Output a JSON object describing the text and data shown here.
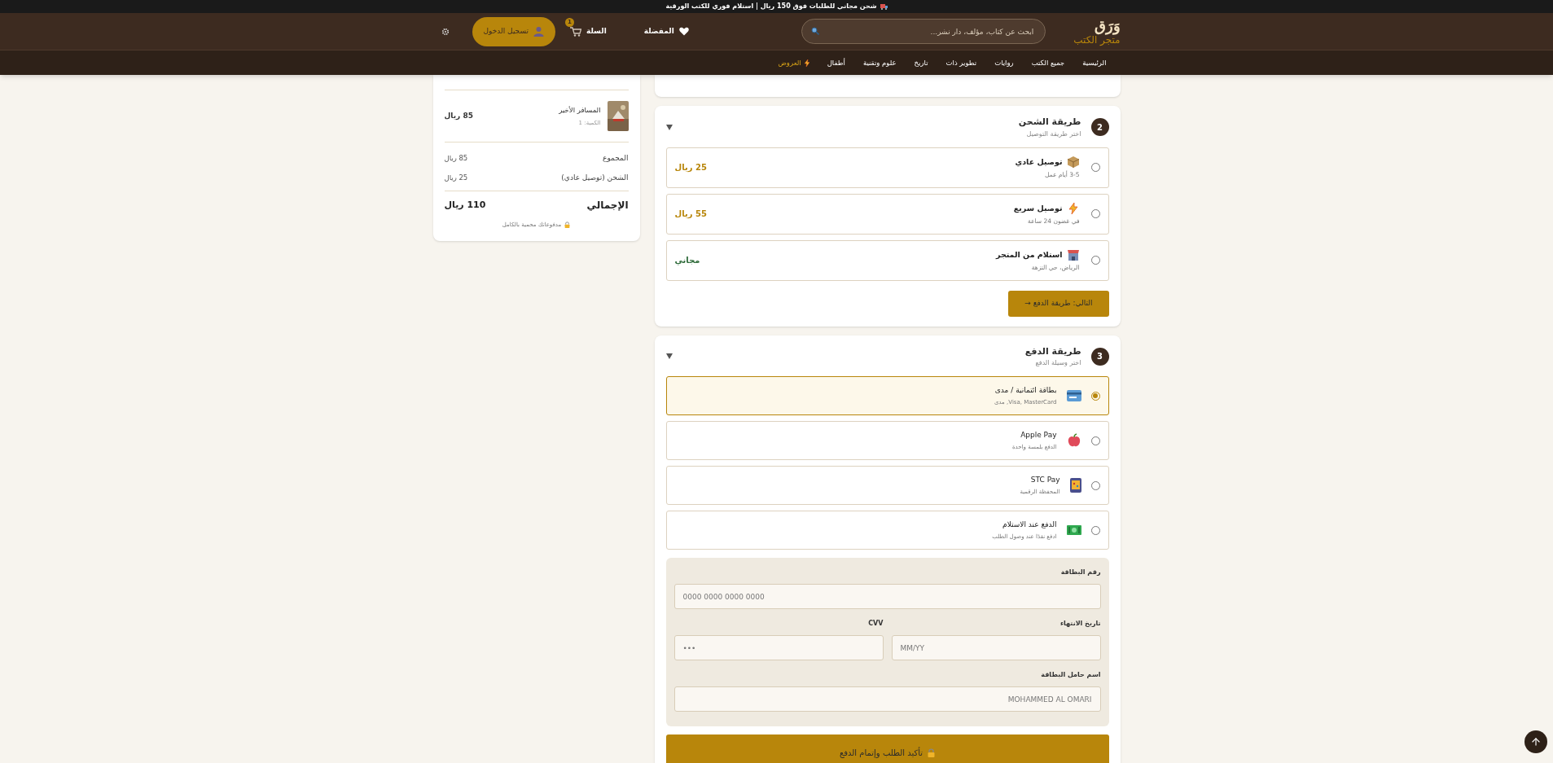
{
  "top_banner": {
    "text": "شحن مجاني للطلبات فوق 150 ريال | استلام فوري للكتب الورقية"
  },
  "header": {
    "logo": "وَرَق",
    "tagline": "متجر الكتب",
    "search": {
      "placeholder": "ابحث عن كتاب، مؤلف، دار نشر..."
    },
    "favorites": "المفضلة",
    "cart": {
      "label": "السلة",
      "count": "1"
    },
    "login": "تسجيل الدخول"
  },
  "nav": [
    {
      "label": "الرئيسية",
      "kind": "link"
    },
    {
      "label": "جميع الكتب",
      "kind": "link"
    },
    {
      "label": "روايات",
      "kind": "link"
    },
    {
      "label": "تطوير ذات",
      "kind": "link"
    },
    {
      "label": "تاريخ",
      "kind": "link"
    },
    {
      "label": "علوم وتقنية",
      "kind": "link"
    },
    {
      "label": "أطفال",
      "kind": "link"
    },
    {
      "label": "العروض",
      "kind": "offer"
    }
  ],
  "summary": {
    "items": [
      {
        "title": "المسافر الأخير",
        "quantity": "الكمية: 1",
        "price": "85 ريال"
      }
    ],
    "rows": [
      {
        "label": "المجموع",
        "value": "85 ريال"
      },
      {
        "label": "الشحن (توصيل عادي)",
        "value": "25 ريال"
      }
    ],
    "total": {
      "label": "الإجمالي",
      "value": "110 ريال"
    },
    "secure_note": "مدفوعاتك محمية بالكامل"
  },
  "shipping": {
    "number": "2",
    "title": "طريقة الشحن",
    "subtitle": "اختر طريقة التوصيل",
    "expanded": true,
    "options": [
      {
        "title": "توصيل عادي",
        "detail": "3-5 أيام عمل",
        "price": "25 ريال",
        "kind": "paid",
        "selected": false
      },
      {
        "title": "توصيل سريع",
        "detail": "في غضون 24 ساعة",
        "price": "55 ريال",
        "kind": "paid",
        "selected": false
      },
      {
        "title": "استلام من المتجر",
        "detail": "الرياض، حي النزهة",
        "price": "مجاني",
        "kind": "free",
        "selected": false
      }
    ],
    "next_button": "التالي: طريقة الدفع →"
  },
  "payment": {
    "number": "3",
    "title": "طريقة الدفع",
    "subtitle": "اختر وسيلة الدفع",
    "expanded": true,
    "options": [
      {
        "title": "بطاقة ائتمانية / مدى",
        "detail": "Visa, MasterCard, مدى",
        "selected": true
      },
      {
        "title": "Apple Pay",
        "detail": "الدفع بلمسة واحدة",
        "selected": false
      },
      {
        "title": "STC Pay",
        "detail": "المحفظة الرقمية",
        "selected": false
      },
      {
        "title": "الدفع عند الاستلام",
        "detail": "ادفع نقدًا عند وصول الطلب",
        "selected": false
      }
    ],
    "card_form": {
      "number": {
        "label": "رقم البطاقة",
        "placeholder": "0000 0000 0000 0000"
      },
      "expiry": {
        "label": "تاريخ الانتهاء",
        "placeholder": "MM/YY"
      },
      "cvv": {
        "label": "CVV",
        "placeholder": "•••"
      },
      "holder": {
        "label": "اسم حامل البطاقة",
        "placeholder": "MOHAMMED AL OMARI"
      }
    },
    "confirm_button": "تأكيد الطلب وإتمام الدفع"
  }
}
